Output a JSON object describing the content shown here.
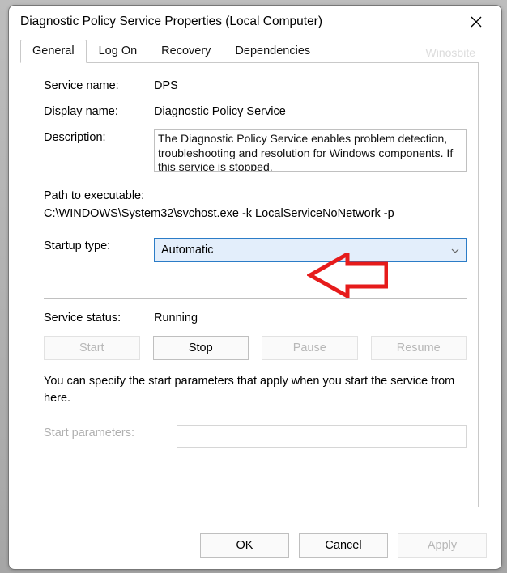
{
  "window": {
    "title": "Diagnostic Policy Service Properties (Local Computer)"
  },
  "tabs": {
    "items": [
      "General",
      "Log On",
      "Recovery",
      "Dependencies"
    ],
    "selected": 0,
    "watermark": "Winosbite"
  },
  "general": {
    "service_name_label": "Service name:",
    "service_name_value": "DPS",
    "display_name_label": "Display name:",
    "display_name_value": "Diagnostic Policy Service",
    "description_label": "Description:",
    "description_value": "The Diagnostic Policy Service enables problem detection, troubleshooting and resolution for Windows components.  If this service is stopped,",
    "path_label": "Path to executable:",
    "path_value": "C:\\WINDOWS\\System32\\svchost.exe -k LocalServiceNoNetwork -p",
    "startup_type_label": "Startup type:",
    "startup_type_value": "Automatic",
    "service_status_label": "Service status:",
    "service_status_value": "Running",
    "buttons": {
      "start": "Start",
      "stop": "Stop",
      "pause": "Pause",
      "resume": "Resume"
    },
    "help_text": "You can specify the start parameters that apply when you start the service from here.",
    "start_parameters_label": "Start parameters:",
    "start_parameters_value": ""
  },
  "footer": {
    "ok": "OK",
    "cancel": "Cancel",
    "apply": "Apply"
  }
}
